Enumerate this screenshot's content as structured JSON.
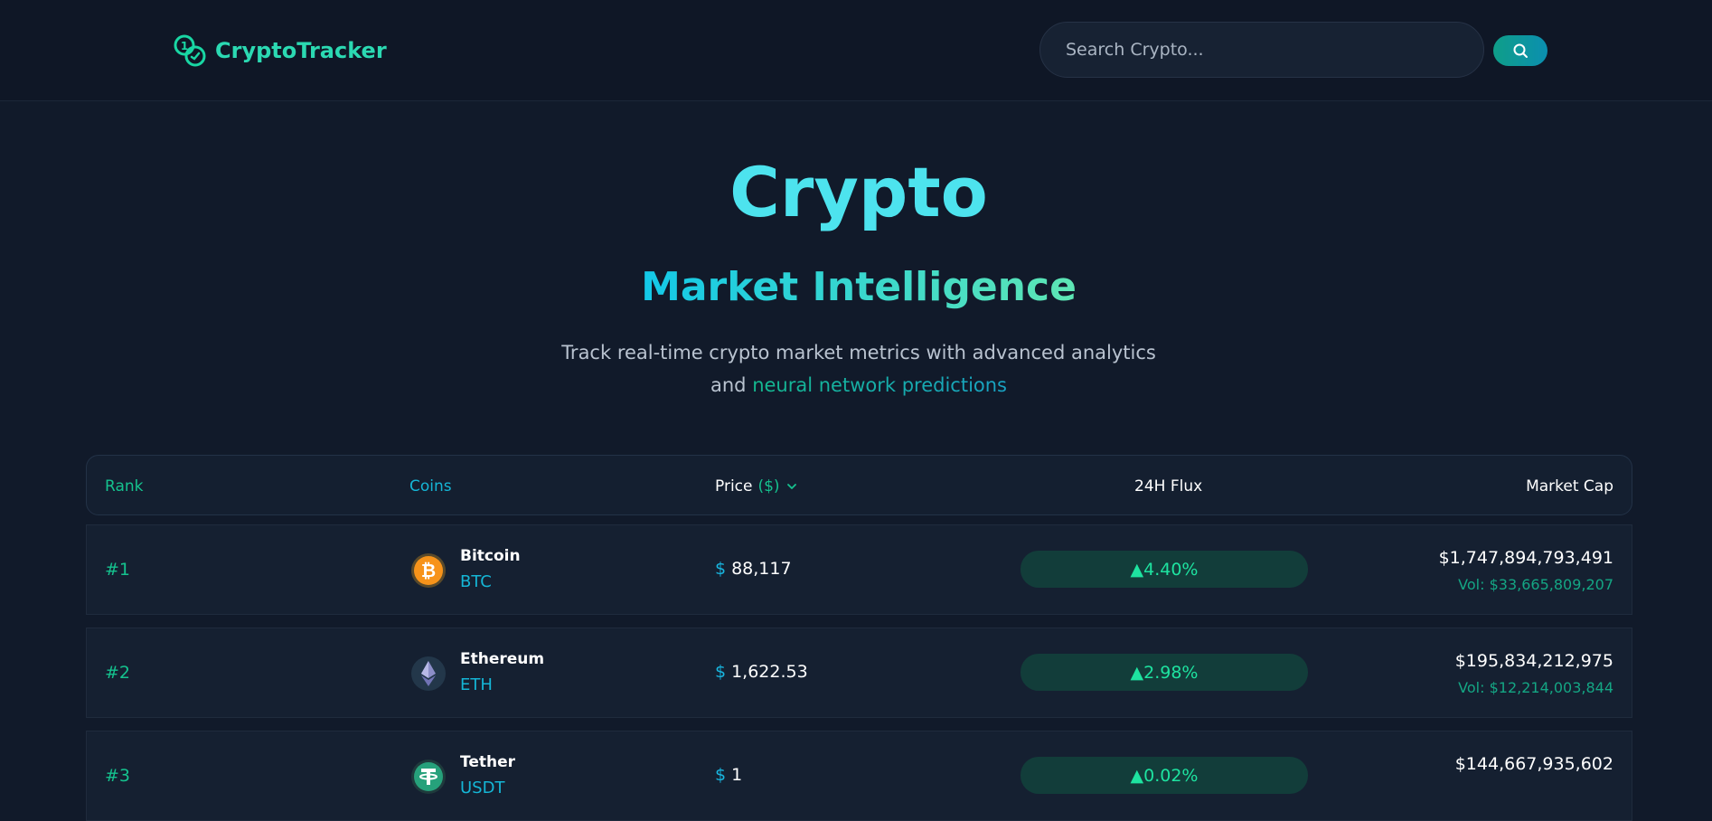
{
  "header": {
    "logo_text": "CryptoTracker",
    "search_placeholder": "Search Crypto..."
  },
  "hero": {
    "title": "Crypto",
    "subtitle": "Market Intelligence",
    "desc_line1": "Track real-time crypto market metrics with advanced analytics",
    "desc_line2_prefix": "and",
    "desc_line2_accent": "neural network predictions"
  },
  "table": {
    "columns": {
      "rank": "Rank",
      "coins": "Coins",
      "price": "Price",
      "price_unit": "($)",
      "flux": "24H Flux",
      "market_cap": "Market Cap"
    },
    "rows": [
      {
        "rank": "#1",
        "name": "Bitcoin",
        "symbol": "BTC",
        "currency": "$",
        "price": "88,117",
        "flux": "▲4.40%",
        "market_cap": "$1,747,894,793,491",
        "volume": "Vol: $33,665,809,207",
        "icon": "bitcoin-icon"
      },
      {
        "rank": "#2",
        "name": "Ethereum",
        "symbol": "ETH",
        "currency": "$",
        "price": "1,622.53",
        "flux": "▲2.98%",
        "market_cap": "$195,834,212,975",
        "volume": "Vol: $12,214,003,844",
        "icon": "ethereum-icon"
      },
      {
        "rank": "#3",
        "name": "Tether",
        "symbol": "USDT",
        "currency": "$",
        "price": "1",
        "flux": "▲0.02%",
        "market_cap": "$144,667,935,602",
        "volume": "",
        "icon": "tether-icon"
      }
    ]
  },
  "colors": {
    "background": "#111a2a",
    "accent_green": "#15c28e",
    "accent_cyan": "#4de3ee",
    "flux_positive": "#1ee3a0"
  }
}
